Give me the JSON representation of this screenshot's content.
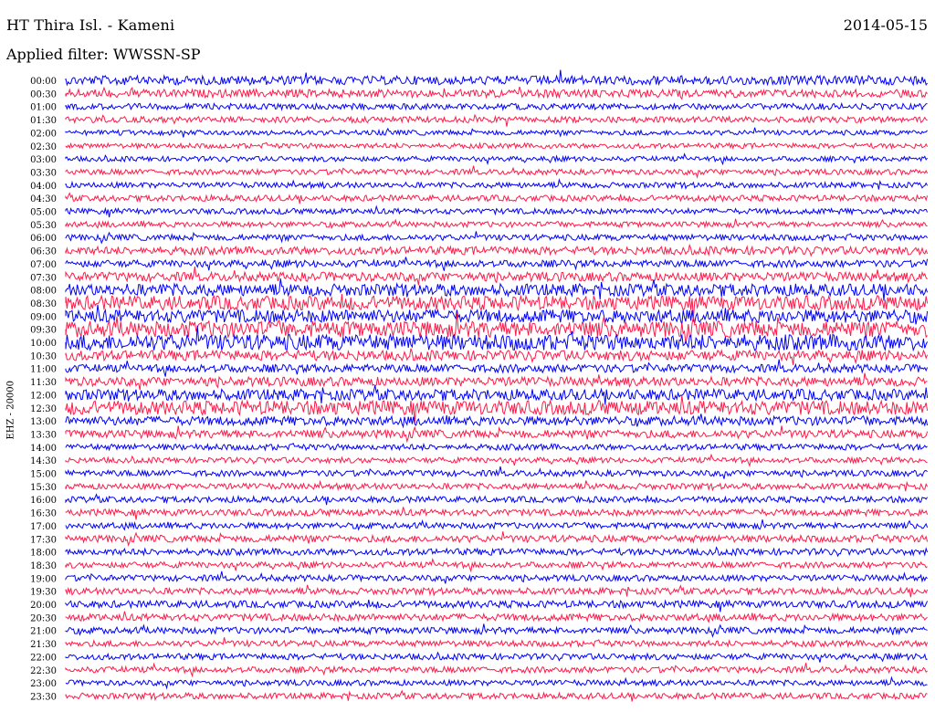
{
  "header": {
    "station": "HT Thira Isl. - Kameni",
    "date": "2014-05-15",
    "filter": "Applied filter: WWSSN-SP"
  },
  "channel_label": "EHZ - 20000",
  "colors": {
    "trace_a": "#0000ff",
    "trace_b": "#ff1a4a"
  },
  "chart_data": {
    "type": "line",
    "ylabel": "EHZ - 20000",
    "row_labels": [
      "00:00",
      "00:30",
      "01:00",
      "01:30",
      "02:00",
      "02:30",
      "03:00",
      "03:30",
      "04:00",
      "04:30",
      "05:00",
      "05:30",
      "06:00",
      "06:30",
      "07:00",
      "07:30",
      "08:00",
      "08:30",
      "09:00",
      "09:30",
      "10:00",
      "10:30",
      "11:00",
      "11:30",
      "12:00",
      "12:30",
      "13:00",
      "13:30",
      "14:00",
      "14:30",
      "15:00",
      "15:30",
      "16:00",
      "16:30",
      "17:00",
      "17:30",
      "18:00",
      "18:30",
      "19:00",
      "19:30",
      "20:00",
      "20:30",
      "21:00",
      "21:30",
      "22:00",
      "22:30",
      "23:00",
      "23:30"
    ],
    "row_minutes": 30,
    "relative_amplitude": [
      0.9,
      0.8,
      0.6,
      0.6,
      0.5,
      0.5,
      0.5,
      0.55,
      0.55,
      0.6,
      0.55,
      0.55,
      0.6,
      0.8,
      0.7,
      0.9,
      1.2,
      1.4,
      1.3,
      1.6,
      1.6,
      1.0,
      0.8,
      0.9,
      1.1,
      1.4,
      0.9,
      0.8,
      0.6,
      0.55,
      0.6,
      0.6,
      0.6,
      0.65,
      0.6,
      0.7,
      0.65,
      0.6,
      0.6,
      0.65,
      0.7,
      0.7,
      0.65,
      0.6,
      0.6,
      0.6,
      0.55,
      0.6
    ],
    "grid": false
  }
}
